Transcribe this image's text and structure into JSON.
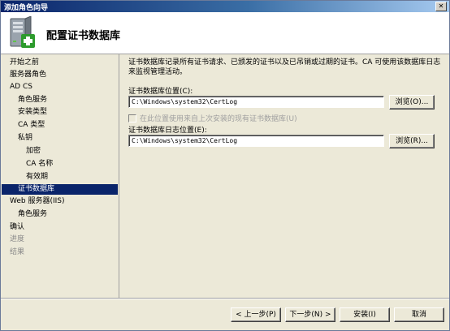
{
  "window": {
    "title": "添加角色向导"
  },
  "header": {
    "title": "配置证书数据库",
    "icon": "server-add-icon"
  },
  "sidebar": {
    "items": [
      {
        "label": "开始之前",
        "indent": 0,
        "state": "normal"
      },
      {
        "label": "服务器角色",
        "indent": 0,
        "state": "normal"
      },
      {
        "label": "AD CS",
        "indent": 0,
        "state": "normal"
      },
      {
        "label": "角色服务",
        "indent": 1,
        "state": "normal"
      },
      {
        "label": "安装类型",
        "indent": 1,
        "state": "normal"
      },
      {
        "label": "CA 类型",
        "indent": 1,
        "state": "normal"
      },
      {
        "label": "私钥",
        "indent": 1,
        "state": "normal"
      },
      {
        "label": "加密",
        "indent": 2,
        "state": "normal"
      },
      {
        "label": "CA 名称",
        "indent": 2,
        "state": "normal"
      },
      {
        "label": "有效期",
        "indent": 2,
        "state": "normal"
      },
      {
        "label": "证书数据库",
        "indent": 1,
        "state": "selected"
      },
      {
        "label": "Web 服务器(IIS)",
        "indent": 0,
        "state": "normal"
      },
      {
        "label": "角色服务",
        "indent": 1,
        "state": "normal"
      },
      {
        "label": "确认",
        "indent": 0,
        "state": "normal"
      },
      {
        "label": "进度",
        "indent": 0,
        "state": "disabled"
      },
      {
        "label": "结果",
        "indent": 0,
        "state": "disabled"
      }
    ]
  },
  "main": {
    "description": "证书数据库记录所有证书请求、已颁发的证书以及已吊销或过期的证书。CA 可使用该数据库日志来监视管理活动。",
    "db_location_label": "证书数据库位置(C):",
    "db_location_value": "C:\\Windows\\system32\\CertLog",
    "db_browse_label": "浏览(O)...",
    "reuse_checkbox_label": "在此位置使用来自上次安装的现有证书数据库(U)",
    "log_location_label": "证书数据库日志位置(E):",
    "log_location_value": "C:\\Windows\\system32\\CertLog",
    "log_browse_label": "浏览(R)..."
  },
  "footer": {
    "prev_label": "< 上一步(P)",
    "next_label": "下一步(N) >",
    "install_label": "安装(I)",
    "cancel_label": "取消"
  }
}
